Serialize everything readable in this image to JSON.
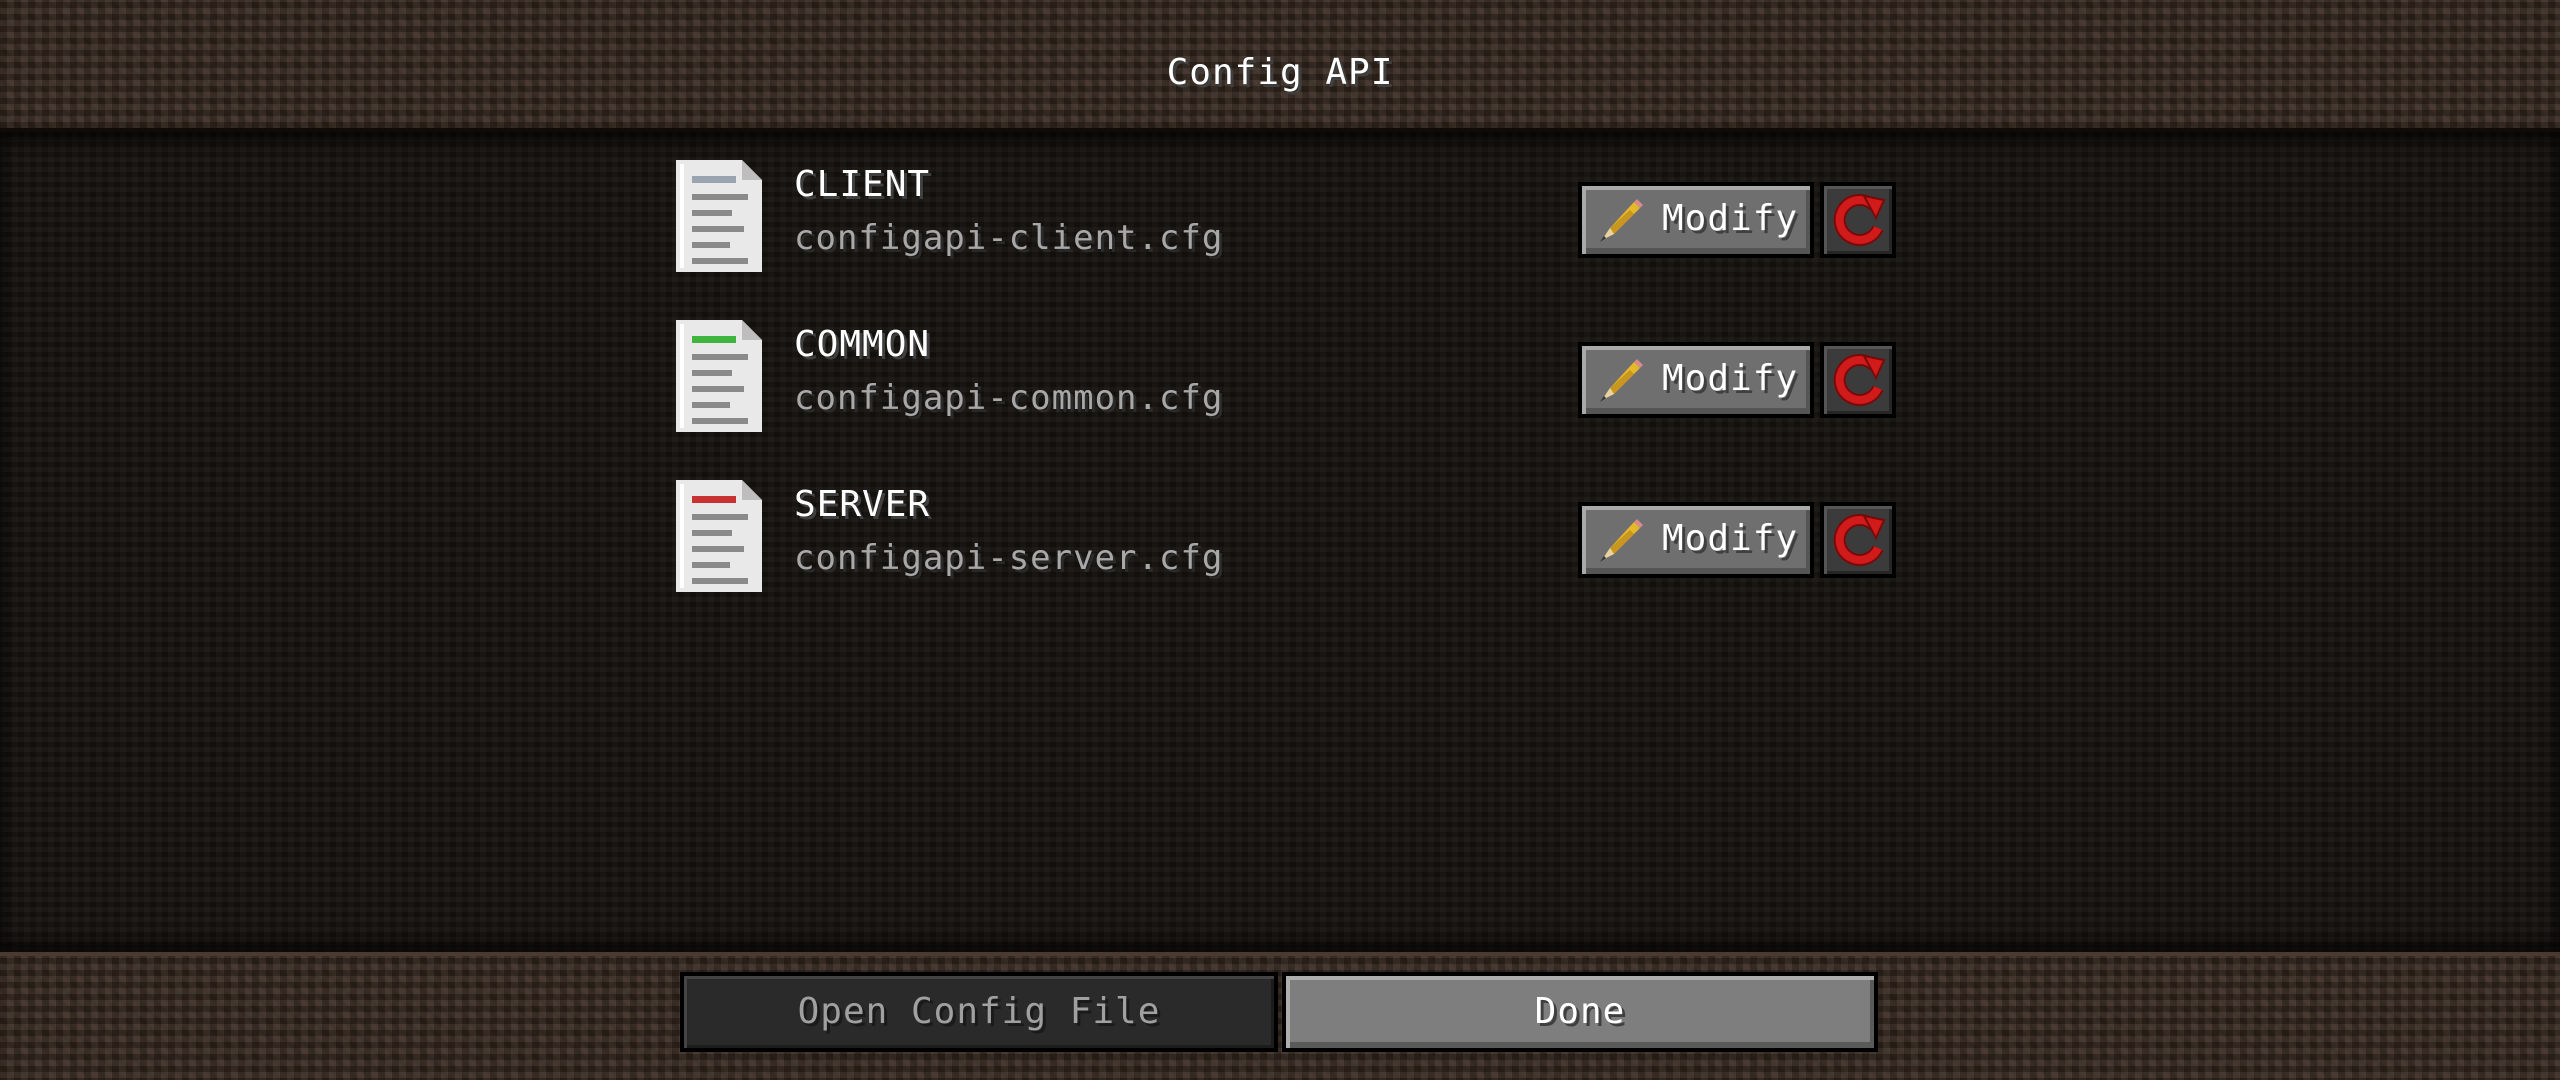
{
  "window": {
    "title": "Config API"
  },
  "configs": [
    {
      "name": "CLIENT",
      "file": "configapi-client.cfg",
      "accent_color": "#9aa4b0",
      "icon": "document-icon"
    },
    {
      "name": "COMMON",
      "file": "configapi-common.cfg",
      "accent_color": "#3fb53f",
      "icon": "document-icon"
    },
    {
      "name": "SERVER",
      "file": "configapi-server.cfg",
      "accent_color": "#c93232",
      "icon": "document-icon"
    }
  ],
  "row_actions": {
    "modify_label": "Modify",
    "modify_icon": "pencil-icon",
    "reset_icon": "reset-icon",
    "reset_color": "#d11a1a"
  },
  "footer": {
    "open_config_label": "Open Config File",
    "done_label": "Done"
  }
}
